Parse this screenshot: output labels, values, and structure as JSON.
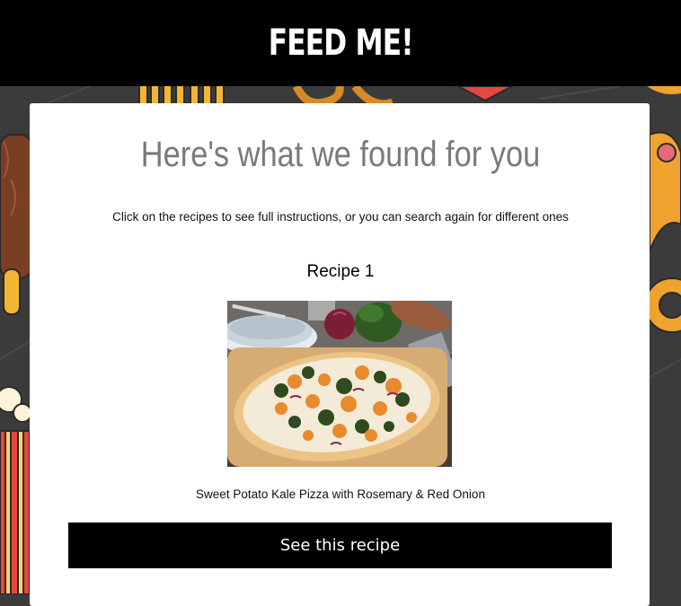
{
  "header": {
    "title": "FEED ME!"
  },
  "results": {
    "heading": "Here's what we found for you",
    "subtext": "Click on the recipes to see full instructions, or you can search again for different ones"
  },
  "recipes": [
    {
      "number_label": "Recipe 1",
      "name": "Sweet Potato Kale Pizza with Rosemary & Red Onion",
      "button_label": "See this recipe"
    }
  ],
  "icons": [
    "food-pattern-background",
    "pizza-photo"
  ],
  "colors": {
    "header_bg": "#000000",
    "page_bg": "#3b3b3b",
    "card_bg": "#ffffff",
    "heading": "#7a7a7a",
    "button_bg": "#000000"
  }
}
